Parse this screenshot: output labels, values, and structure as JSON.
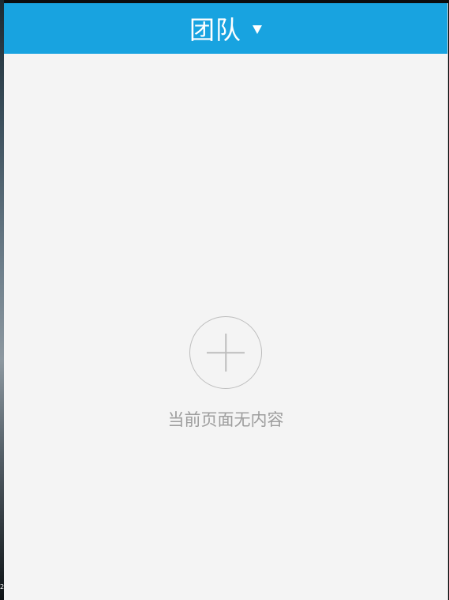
{
  "header": {
    "title": "团队"
  },
  "empty_state": {
    "message": "当前页面无内容"
  },
  "background": {
    "left_edge_label": "2"
  },
  "colors": {
    "header": "#18a3e0",
    "content_background": "#f4f4f4",
    "empty_state_gray": "#9e9e9e"
  },
  "icons": {
    "dropdown": "caret-down-icon",
    "add": "plus-icon"
  }
}
